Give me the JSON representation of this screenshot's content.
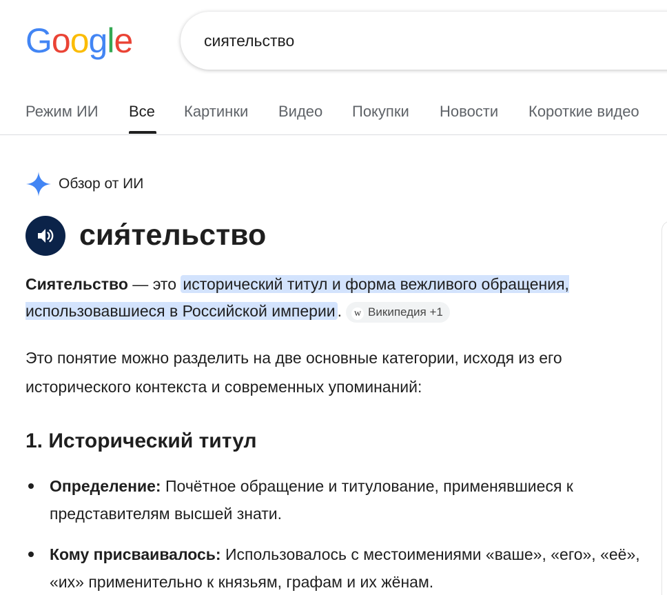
{
  "search": {
    "query": "сиятельство"
  },
  "tabs": [
    {
      "label": "Режим ИИ"
    },
    {
      "label": "Все"
    },
    {
      "label": "Картинки"
    },
    {
      "label": "Видео"
    },
    {
      "label": "Покупки"
    },
    {
      "label": "Новости"
    },
    {
      "label": "Короткие видео"
    }
  ],
  "ai_overview": {
    "title": "Обзор от ИИ",
    "word": "сия́тельство",
    "def_bold": "Сиятельство",
    "def_dash": " — это ",
    "def_highlight": "исторический титул и форма вежливого обращения, использовавшиеся в Российской империи",
    "def_end": ".",
    "source_chip": "Википедия +1",
    "source_icon_letter": "w",
    "intro": "Это понятие можно разделить на две основные категории, исходя из его исторического контекста и современных упоминаний:",
    "section1_title": "1. Исторический титул",
    "bullets": [
      {
        "label": "Определение:",
        "text": " Почётное обращение и титулование, применявшиеся к представителям высшей знати."
      },
      {
        "label": "Кому присваивалось:",
        "text": " Использовалось с местоимениями «ваше», «его», «её», «их» применительно к князьям, графам и их жёнам."
      }
    ]
  },
  "colors": {
    "highlight": "#d3e3fd",
    "speaker_bg": "#0b2349",
    "sparkle": "#4285f4"
  }
}
